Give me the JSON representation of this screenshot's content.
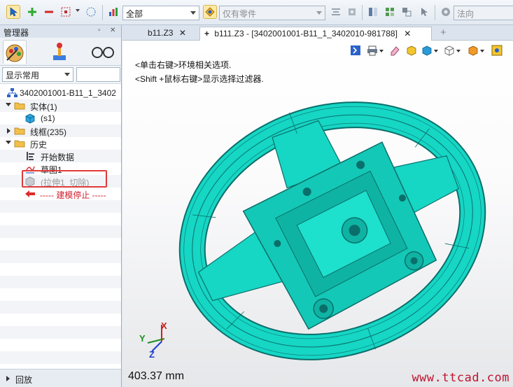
{
  "toolbar": {
    "filter_value": "全部",
    "parts_filter_value": "仅有零件",
    "direction_value": "法向"
  },
  "manager": {
    "title": "管理器",
    "display_option": "显示常用",
    "tree": {
      "root": "3402001001-B11_1_3402",
      "solid_group": "实体(1)",
      "solid_item": "(s1)",
      "wireframe_group": "线框(235)",
      "history_group": "历史",
      "start_data": "开始数据",
      "sketch": "草图1",
      "extrude_cut": "(拉伸1_切除)",
      "stop_marker": "----- 建模停止 -----"
    },
    "rollback": "回放"
  },
  "tabs": [
    {
      "label": "b11.Z3"
    },
    {
      "label": "b111.Z3 - [3402001001-B11_1_3402010-981788]"
    }
  ],
  "viewport": {
    "hint_line1": "<单击右键>环境相关选项.",
    "hint_line2": "<Shift +鼠标右键>显示选择过滤器.",
    "measure": "403.37 mm",
    "axis_x": "X",
    "axis_y": "Y",
    "axis_z": "Z",
    "watermark": "www.ttcad.com"
  },
  "colors": {
    "model": "#16d6c4",
    "model_dark": "#0a6f6a",
    "highlight": "#e03b3b",
    "accent": "#d31f2c"
  }
}
